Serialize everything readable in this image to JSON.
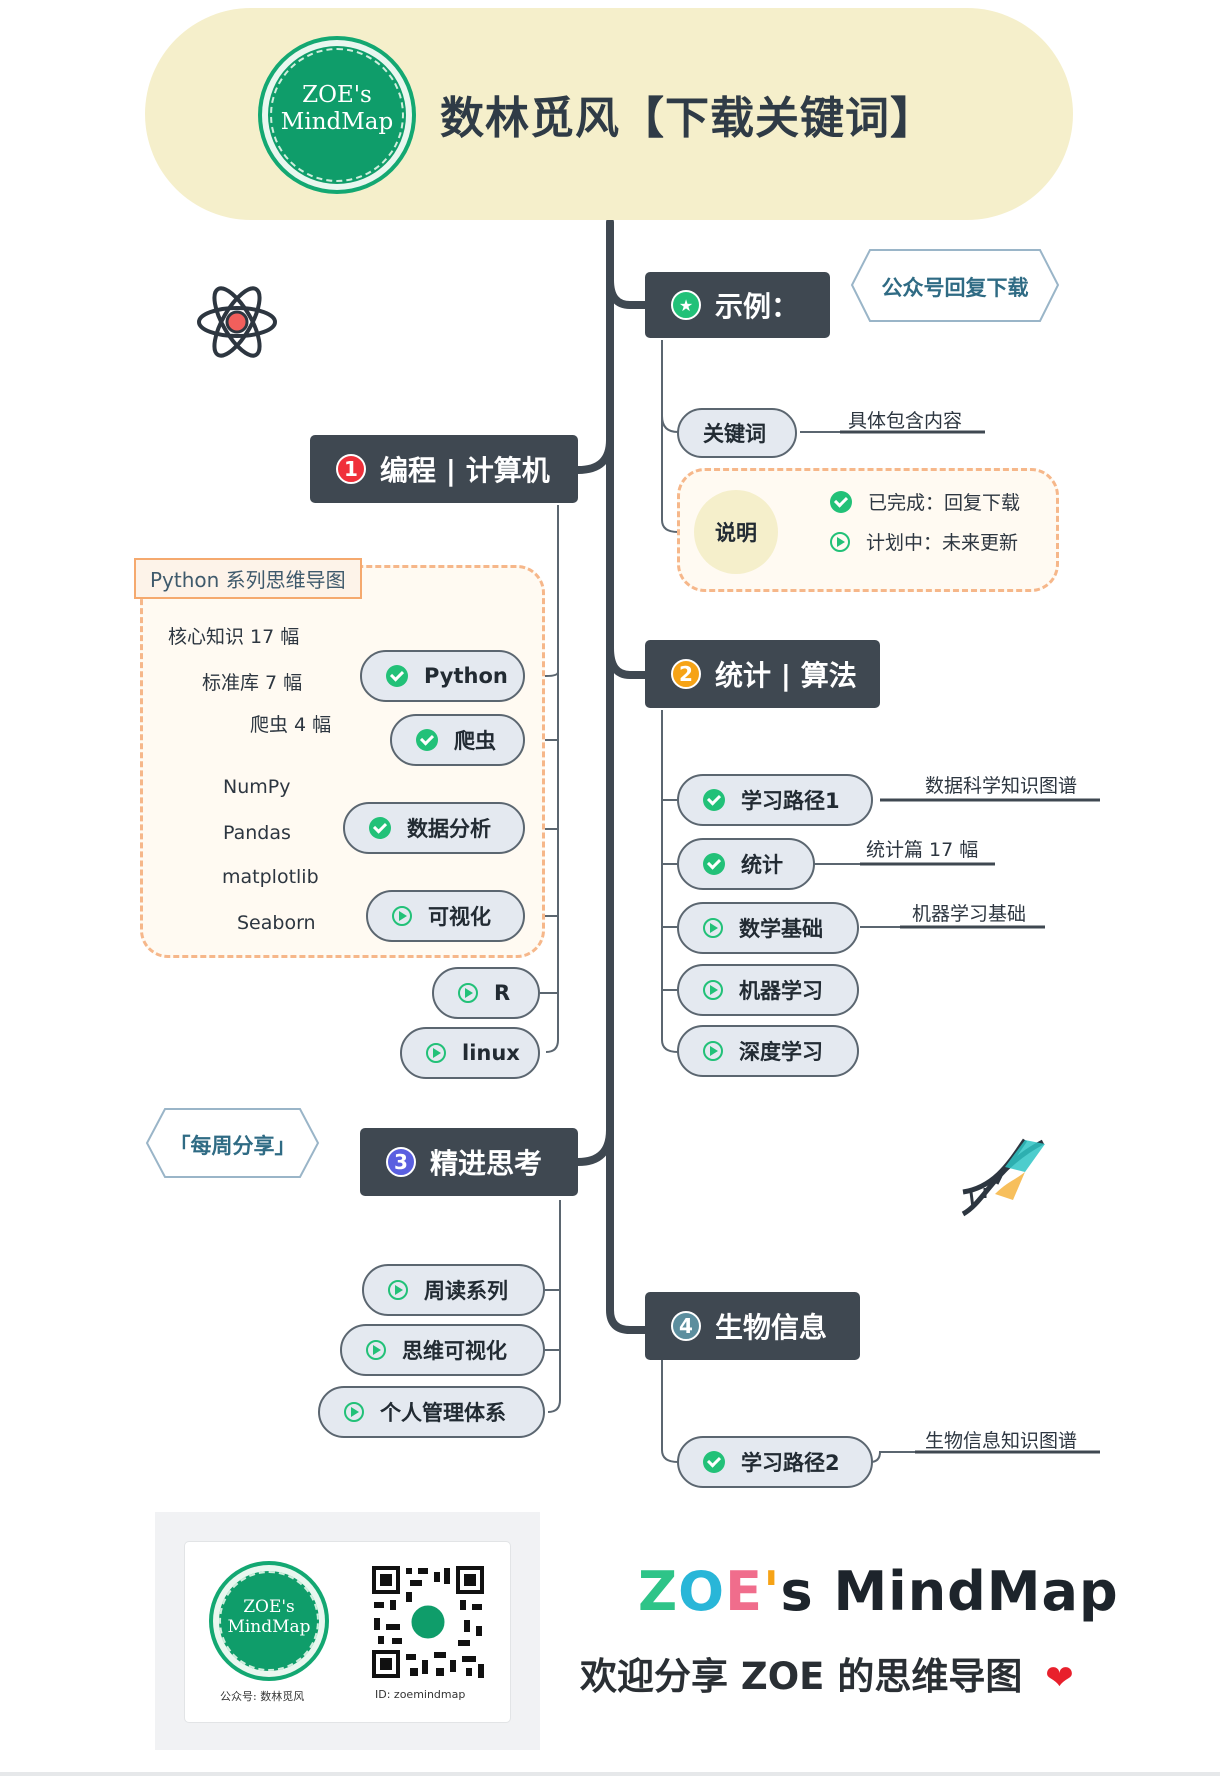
{
  "header": {
    "logo_line1": "ZOE's",
    "logo_line2": "MindMap",
    "title": "数林觅风【下载关键词】"
  },
  "example": {
    "title": "示例：",
    "hex_label": "公众号回复下载",
    "keyword_pill": "关键词",
    "keyword_leaf": "具体包含内容",
    "note_node": "说明",
    "done_leaf": "已完成：回复下载",
    "plan_leaf": "计划中：未来更新"
  },
  "branch1": {
    "number": "1",
    "title": "编程 | 计算机",
    "python_series_tag": "Python 系列思维导图",
    "python_pill": "Python",
    "python_leaves": [
      "核心知识 17 幅",
      "标准库 7 幅"
    ],
    "spider_pill": "爬虫",
    "spider_leaf": "爬虫 4 幅",
    "analysis_pill": "数据分析",
    "analysis_leaves": [
      "NumPy",
      "Pandas"
    ],
    "viz_pill": "可视化",
    "viz_leaves": [
      "matplotlib",
      "Seaborn"
    ],
    "r_pill": "R",
    "linux_pill": "linux"
  },
  "branch2": {
    "number": "2",
    "title": "统计 | 算法",
    "items": [
      {
        "label": "学习路径1",
        "leaf": "数据科学知识图谱"
      },
      {
        "label": "统计",
        "leaf": "统计篇 17 幅"
      },
      {
        "label": "数学基础",
        "leaf": "机器学习基础"
      },
      {
        "label": "机器学习",
        "leaf": ""
      },
      {
        "label": "深度学习",
        "leaf": ""
      }
    ]
  },
  "branch3": {
    "number": "3",
    "title": "精进思考",
    "hex_label": "「每周分享」",
    "items": [
      "周读系列",
      "思维可视化",
      "个人管理体系"
    ]
  },
  "branch4": {
    "number": "4",
    "title": "生物信息",
    "item": "学习路径2",
    "leaf": "生物信息知识图谱"
  },
  "footer": {
    "logo_line1": "ZOE's",
    "logo_line2": "MindMap",
    "account_caption": "公众号: 数林觅风",
    "id_caption": "ID: zoemindmap",
    "brand_parts": [
      "Z",
      "O",
      "E",
      "'",
      "s MindMap"
    ],
    "welcome": "欢迎分享 ZOE 的思维导图"
  },
  "colors": {
    "dark_node": "#3f4851",
    "pill_fill": "#e4e9f0",
    "check_green": "#22c178",
    "badge_red": "#f0303a",
    "badge_orange": "#f6a316",
    "badge_blue": "#5a5fe0",
    "badge_teal": "#5c8e9e",
    "header_bg": "#f5efcb",
    "dashed_orange": "#f6b78a"
  },
  "icons": [
    "star-icon",
    "check-icon",
    "play-icon",
    "atom-icon",
    "dna-icon",
    "heart-icon",
    "qr-code-icon"
  ]
}
